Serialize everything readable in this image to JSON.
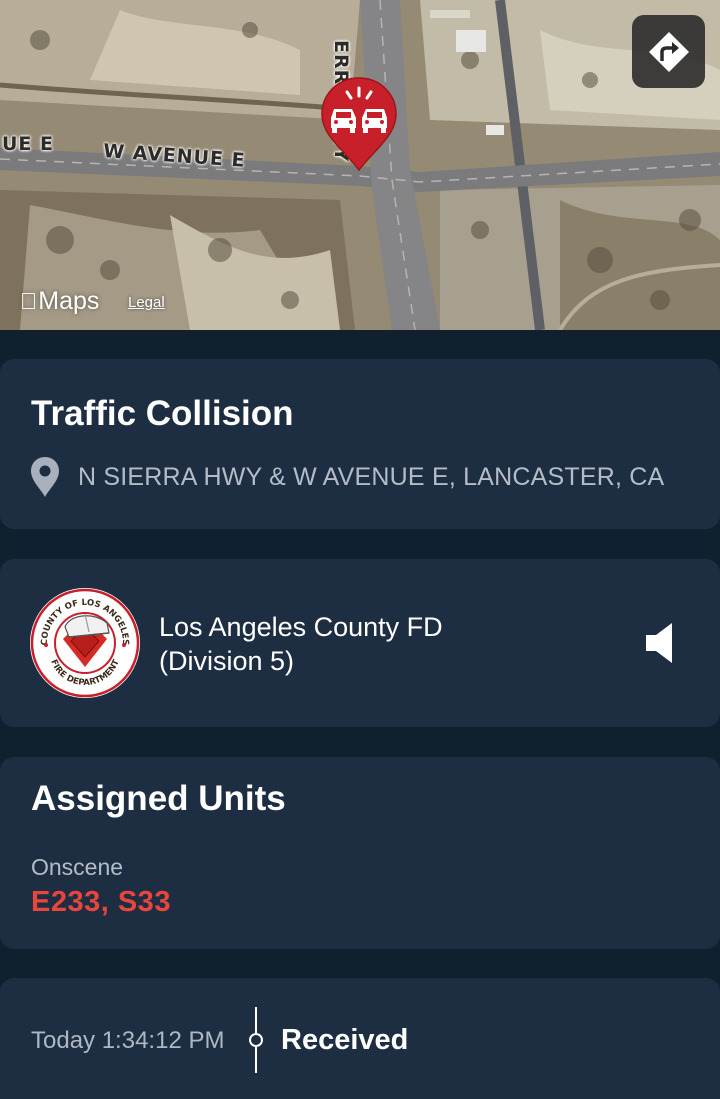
{
  "map": {
    "road_labels": [
      "UE E",
      "W AVENUE E",
      "ERRA HWY"
    ],
    "brand": "Maps",
    "legal": "Legal",
    "pin_icon": "traffic-collision-icon",
    "directions_icon": "directions-icon"
  },
  "incident": {
    "title": "Traffic Collision",
    "address": "N SIERRA HWY & W AVENUE E, LANCASTER, CA",
    "location_icon": "location-pin-icon"
  },
  "agency": {
    "name_line1": "Los Angeles County FD",
    "name_line2": "(Division 5)",
    "logo_text_top": "COUNTY OF LOS ANGELES",
    "logo_text_bottom": "FIRE DEPARTMENT",
    "audio_icon": "speaker-icon"
  },
  "units": {
    "title": "Assigned Units",
    "status": "Onscene",
    "list": "E233, S33"
  },
  "timeline": {
    "time": "Today 1:34:12 PM",
    "status": "Received"
  },
  "colors": {
    "background": "#11202f",
    "card": "#1e2e42",
    "accent_red": "#e8453c",
    "pin_red": "#c8202a",
    "muted_text": "#b3bcc8"
  }
}
